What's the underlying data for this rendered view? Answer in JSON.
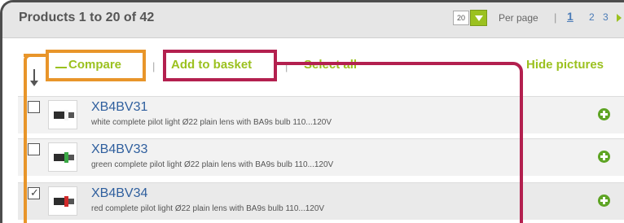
{
  "header": {
    "title": "Products 1 to 20 of 42",
    "per_page_value": "20",
    "per_page_label": "Per page",
    "pager_separator": "|",
    "pages": [
      "1",
      "2",
      "3"
    ]
  },
  "toolbar": {
    "compare_label": "Compare",
    "add_to_basket_label": "Add to basket",
    "select_all_label": "Select all",
    "hide_pictures_label": "Hide pictures",
    "separator": "|"
  },
  "products": [
    {
      "code": "XB4BV31",
      "description": "white complete pilot light Ø22 plain lens with BA9s bulb 110...120V",
      "checked": false,
      "lens_color": "#f4f4f4"
    },
    {
      "code": "XB4BV33",
      "description": "green complete pilot light Ø22 plain lens with BA9s bulb 110...120V",
      "checked": false,
      "lens_color": "#3aa845"
    },
    {
      "code": "XB4BV34",
      "description": "red complete pilot light Ø22 plain lens with BA9s bulb 110...120V",
      "checked": true,
      "check_mark": "✓",
      "lens_color": "#d02a2a"
    }
  ],
  "icons": {
    "sort_arrow": "down-arrow-icon",
    "add": "plus-circle-icon",
    "dropdown": "chevron-down-icon",
    "next": "play-triangle-icon"
  },
  "colors": {
    "accent_green": "#9bc11f",
    "link_blue": "#2f5f9e",
    "highlight_orange": "#e8952a",
    "highlight_red": "#b3204f"
  }
}
